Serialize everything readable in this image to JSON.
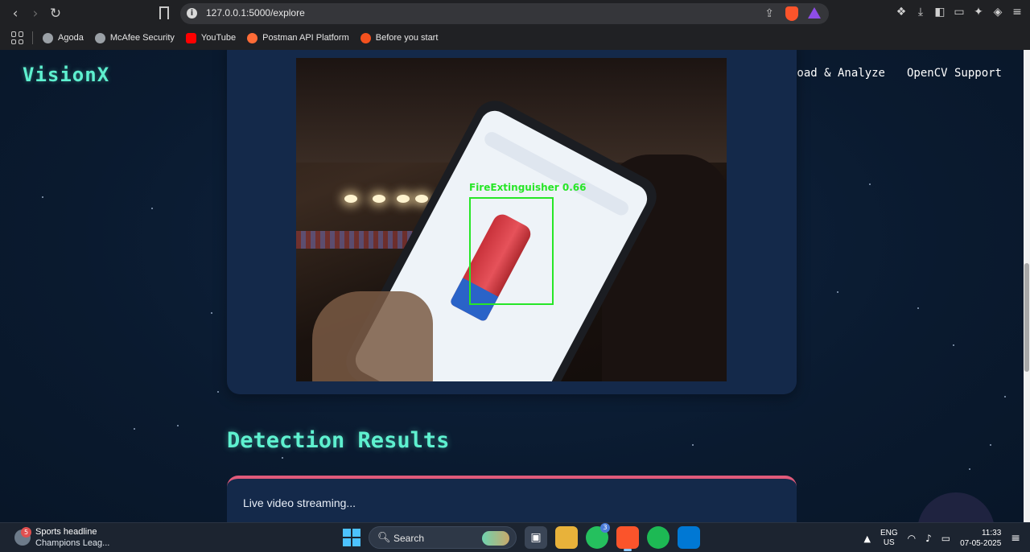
{
  "browser": {
    "url": "127.0.0.1:5000/explore",
    "bookmarks": [
      {
        "label": "Agoda",
        "color": "#9aa0a6"
      },
      {
        "label": "McAfee Security",
        "color": "#9aa0a6"
      },
      {
        "label": "YouTube",
        "color": "#ff0000"
      },
      {
        "label": "Postman API Platform",
        "color": "#ff6c37"
      },
      {
        "label": "Before you start",
        "color": "#f4511e"
      }
    ]
  },
  "site": {
    "logo": "VisionX",
    "nav": [
      "Upload & Analyze",
      "OpenCV Support"
    ],
    "accent": "#5ef0cf"
  },
  "video": {
    "detection_label": "FireExtinguisher 0.66",
    "box_color": "#27e627"
  },
  "results": {
    "title": "Detection Results",
    "status": "Live video streaming...",
    "border_color": "#e05a7a"
  },
  "taskbar": {
    "news_badge": "5",
    "news_title": "Sports headline",
    "news_subtitle": "Champions Leag...",
    "search_placeholder": "Search",
    "whatsapp_badge": "3",
    "lang_line1": "ENG",
    "lang_line2": "US",
    "time": "11:33",
    "date": "07-05-2025"
  }
}
